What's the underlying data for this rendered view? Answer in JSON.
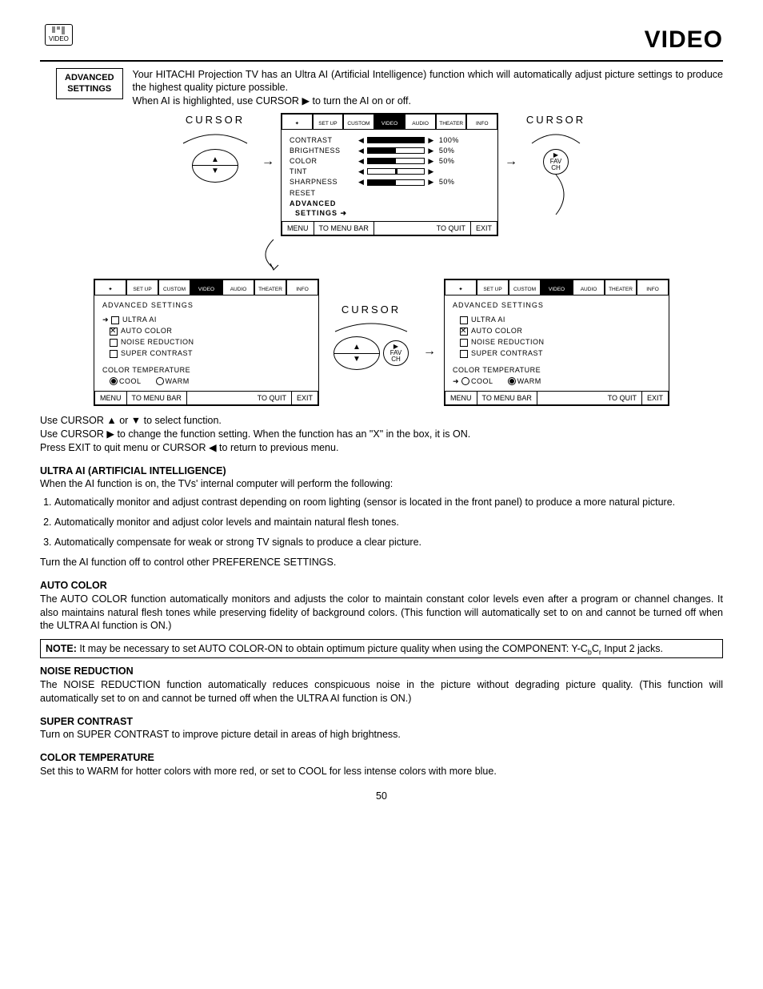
{
  "page": {
    "icon_label": "VIDEO",
    "title": "VIDEO",
    "number": "50"
  },
  "intro": {
    "box_line1": "ADVANCED",
    "box_line2": "SETTINGS",
    "para": "Your HITACHI Projection TV has an Ultra AI (Artificial Intelligence) function which will automatically adjust picture settings to produce the highest quality picture possible.",
    "line2a": "When AI is highlighted, use CURSOR ",
    "line2b": " to turn the AI on or off."
  },
  "tabs": [
    "SET UP",
    "CUSTOM",
    "VIDEO",
    "AUDIO",
    "THEATER",
    "INFO"
  ],
  "cursor_label": "CURSOR",
  "fav": {
    "l1": "FAV",
    "l2": "CH"
  },
  "video_menu": {
    "contrast": {
      "label": "CONTRAST",
      "pct": "100%",
      "fill": 100
    },
    "brightness": {
      "label": "BRIGHTNESS",
      "pct": "50%",
      "fill": 50
    },
    "color": {
      "label": "COLOR",
      "pct": "50%",
      "fill": 50
    },
    "tint": {
      "label": "TINT",
      "pct": "",
      "fill": 50,
      "center": true
    },
    "sharpness": {
      "label": "SHARPNESS",
      "pct": "50%",
      "fill": 50
    },
    "reset": "RESET",
    "adv1": "ADVANCED",
    "adv2": "SETTINGS"
  },
  "hints": {
    "menu": "MENU",
    "bar": "TO MENU BAR",
    "quit": "TO QUIT",
    "exit": "EXIT"
  },
  "adv_menu": {
    "title": "ADVANCED SETTINGS",
    "ultra": "ULTRA AI",
    "auto": "AUTO COLOR",
    "noise": "NOISE REDUCTION",
    "super": "SUPER CONTRAST",
    "ct": "COLOR TEMPERATURE",
    "cool": "COOL",
    "warm": "WARM"
  },
  "instructions": {
    "l1a": "Use CURSOR ",
    "l1b": " or ",
    "l1c": " to select function.",
    "l2a": "Use CURSOR ",
    "l2b": " to change the function setting. When the function has an \"X\" in the box, it is ON.",
    "l3a": "Press EXIT to quit menu or CURSOR ",
    "l3b": " to return to previous menu."
  },
  "sections": {
    "ultra_h": "ULTRA AI (ARTIFICIAL INTELLIGENCE)",
    "ultra_intro": "When the AI function is on, the TVs' internal computer will perform the following:",
    "ultra_li1": "Automatically monitor and adjust contrast depending on room lighting (sensor is located in the front panel) to produce a more natural picture.",
    "ultra_li2": "Automatically monitor and adjust color levels and maintain natural flesh tones.",
    "ultra_li3": "Automatically compensate for weak or strong TV signals to produce a clear picture.",
    "ultra_out": "Turn the AI function off to control other PREFERENCE SETTINGS.",
    "auto_h": "AUTO COLOR",
    "auto_p": "The AUTO COLOR function automatically monitors and adjusts the color to maintain constant color levels even after a program or channel changes. It also maintains natural flesh tones while preserving fidelity of background colors. (This function will automatically set to on and cannot be turned off when the ULTRA AI function is ON.)",
    "note_strong": "NOTE:",
    "note_a": " It may be necessary to set AUTO COLOR-ON to obtain optimum picture quality when using the COMPONENT: Y-C",
    "note_b": "b",
    "note_c": "C",
    "note_d": "r",
    "note_e": " Input 2 jacks.",
    "noise_h": "NOISE REDUCTION",
    "noise_p": "The NOISE REDUCTION function automatically reduces conspicuous noise in the picture without degrading picture quality. (This function will automatically set to on and cannot be turned off when the ULTRA AI function is ON.)",
    "super_h": "SUPER CONTRAST",
    "super_p": "Turn on SUPER CONTRAST to improve picture detail in areas of high brightness.",
    "ct_h": "COLOR TEMPERATURE",
    "ct_p": "Set this to WARM for hotter colors with more red, or set to COOL for less intense colors with more blue."
  }
}
